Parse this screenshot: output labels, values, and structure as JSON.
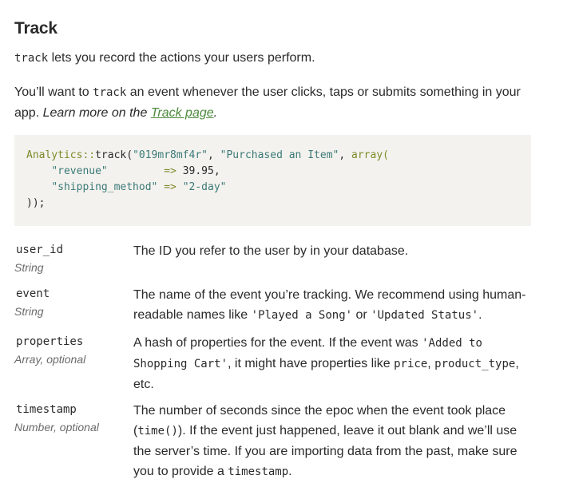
{
  "title": "Track",
  "intro": {
    "code": "track",
    "text": " lets you record the actions your users perform."
  },
  "usage": {
    "text_1": "You’ll want to ",
    "code": "track",
    "text_2": " an event whenever the user clicks, taps or submits something in your app. ",
    "learn_more": "Learn more on the ",
    "link_text": "Track page",
    "trailing": "."
  },
  "code": {
    "line1_cls": "Analytics::",
    "line1_fn": "track(",
    "line1_arg1": "\"019mr8mf4r\"",
    "line1_comma1": ", ",
    "line1_arg2": "\"Purchased an Item\"",
    "line1_comma2": ", ",
    "line1_array": "array(",
    "line2_key": "\"revenue\"",
    "line2_arrow": "=>",
    "line2_val": "39.95",
    "line2_comma": ",",
    "line3_key": "\"shipping_method\"",
    "line3_arrow": "=>",
    "line3_val": "\"2-day\"",
    "line4": "));"
  },
  "params": {
    "user_id": {
      "name": "user_id",
      "type": "String",
      "desc": "The ID you refer to the user by in your database."
    },
    "event": {
      "name": "event",
      "type": "String",
      "desc_1": "The name of the event you’re tracking. We recommend using human-readable names like ",
      "code_1": "'Played a Song'",
      "desc_2": " or ",
      "code_2": "'Updated Status'",
      "desc_3": "."
    },
    "properties": {
      "name": "properties",
      "type": "Array, optional",
      "desc_1": "A hash of properties for the event. If the event was ",
      "code_1": "'Added to Shopping Cart'",
      "desc_2": ", it might have properties like ",
      "code_2": "price",
      "desc_3": ", ",
      "code_3": "product_type",
      "desc_4": ", etc."
    },
    "timestamp": {
      "name": "timestamp",
      "type": "Number, optional",
      "desc_1": "The number of seconds since the epoc when the event took place (",
      "code_1": "time()",
      "desc_2": "). If the event just happened, leave it out blank and we’ll use the server’s time. If you are importing data from the past, make sure you to provide a ",
      "code_2": "timestamp",
      "desc_3": "."
    }
  },
  "colors": {
    "link": "#4c8a3c",
    "code_bg": "#f4f2ee",
    "code_class": "#7d8b2a",
    "code_string": "#3a7a78",
    "type_text": "#6a6a6a"
  }
}
